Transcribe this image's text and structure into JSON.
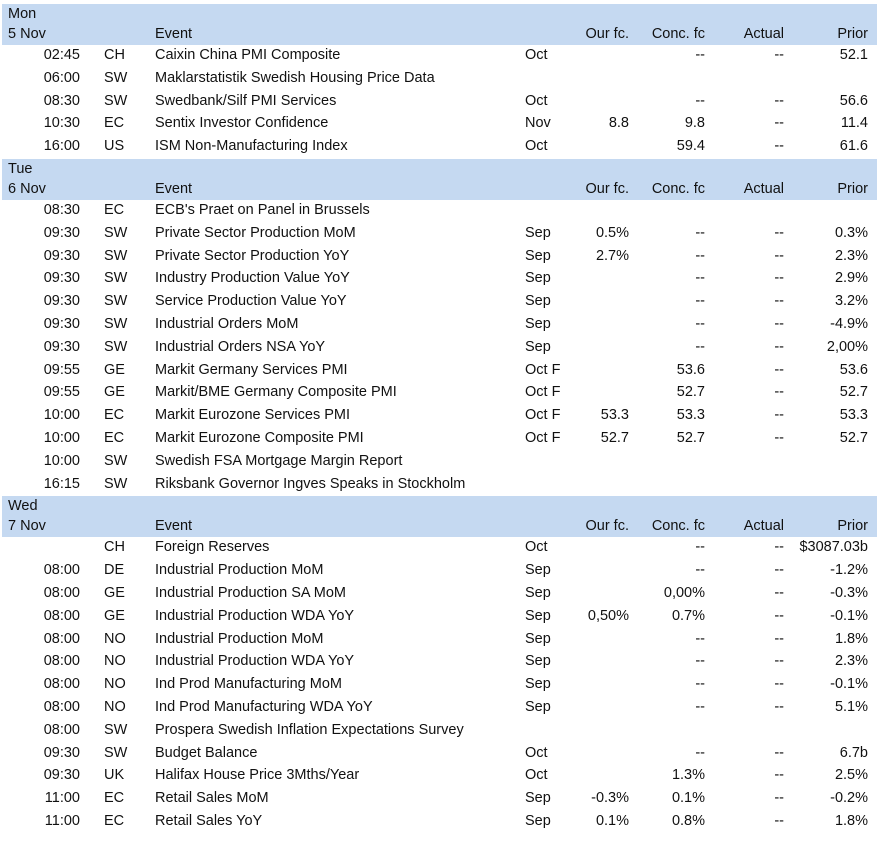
{
  "headers": {
    "event": "Event",
    "our_fc": "Our fc.",
    "conc_fc": "Conc. fc",
    "actual": "Actual",
    "prior": "Prior"
  },
  "days": [
    {
      "day": "Mon",
      "date": "5 Nov",
      "rows": [
        {
          "time": "02:45",
          "country": "CH",
          "event": "Caixin China PMI Composite",
          "period": "Oct",
          "our_fc": "",
          "conc_fc": "--",
          "actual": "--",
          "prior": "52.1"
        },
        {
          "time": "06:00",
          "country": "SW",
          "event": "Maklarstatistik Swedish Housing Price Data",
          "period": "",
          "our_fc": "",
          "conc_fc": "",
          "actual": "",
          "prior": ""
        },
        {
          "time": "08:30",
          "country": "SW",
          "event": "Swedbank/Silf PMI Services",
          "period": "Oct",
          "our_fc": "",
          "conc_fc": "--",
          "actual": "--",
          "prior": "56.6"
        },
        {
          "time": "10:30",
          "country": "EC",
          "event": "Sentix Investor Confidence",
          "period": "Nov",
          "our_fc": "8.8",
          "conc_fc": "9.8",
          "actual": "--",
          "prior": "11.4"
        },
        {
          "time": "16:00",
          "country": "US",
          "event": "ISM Non-Manufacturing Index",
          "period": "Oct",
          "our_fc": "",
          "conc_fc": "59.4",
          "actual": "--",
          "prior": "61.6"
        }
      ]
    },
    {
      "day": "Tue",
      "date": "6 Nov",
      "rows": [
        {
          "time": "08:30",
          "country": "EC",
          "event": "ECB's Praet on Panel in Brussels",
          "period": "",
          "our_fc": "",
          "conc_fc": "",
          "actual": "",
          "prior": ""
        },
        {
          "time": "09:30",
          "country": "SW",
          "event": "Private Sector Production MoM",
          "period": "Sep",
          "our_fc": "0.5%",
          "conc_fc": "--",
          "actual": "--",
          "prior": "0.3%"
        },
        {
          "time": "09:30",
          "country": "SW",
          "event": "Private Sector Production YoY",
          "period": "Sep",
          "our_fc": "2.7%",
          "conc_fc": "--",
          "actual": "--",
          "prior": "2.3%"
        },
        {
          "time": "09:30",
          "country": "SW",
          "event": "Industry Production Value YoY",
          "period": "Sep",
          "our_fc": "",
          "conc_fc": "--",
          "actual": "--",
          "prior": "2.9%"
        },
        {
          "time": "09:30",
          "country": "SW",
          "event": "Service Production Value YoY",
          "period": "Sep",
          "our_fc": "",
          "conc_fc": "--",
          "actual": "--",
          "prior": "3.2%"
        },
        {
          "time": "09:30",
          "country": "SW",
          "event": "Industrial Orders MoM",
          "period": "Sep",
          "our_fc": "",
          "conc_fc": "--",
          "actual": "--",
          "prior": "-4.9%"
        },
        {
          "time": "09:30",
          "country": "SW",
          "event": "Industrial Orders NSA YoY",
          "period": "Sep",
          "our_fc": "",
          "conc_fc": "--",
          "actual": "--",
          "prior": "2,00%"
        },
        {
          "time": "09:55",
          "country": "GE",
          "event": "Markit Germany Services PMI",
          "period": "Oct F",
          "our_fc": "",
          "conc_fc": "53.6",
          "actual": "--",
          "prior": "53.6"
        },
        {
          "time": "09:55",
          "country": "GE",
          "event": "Markit/BME Germany Composite PMI",
          "period": "Oct F",
          "our_fc": "",
          "conc_fc": "52.7",
          "actual": "--",
          "prior": "52.7"
        },
        {
          "time": "10:00",
          "country": "EC",
          "event": "Markit Eurozone Services PMI",
          "period": "Oct F",
          "our_fc": "53.3",
          "conc_fc": "53.3",
          "actual": "--",
          "prior": "53.3"
        },
        {
          "time": "10:00",
          "country": "EC",
          "event": "Markit Eurozone Composite PMI",
          "period": "Oct F",
          "our_fc": "52.7",
          "conc_fc": "52.7",
          "actual": "--",
          "prior": "52.7"
        },
        {
          "time": "10:00",
          "country": "SW",
          "event": "Swedish FSA Mortgage Margin Report",
          "period": "",
          "our_fc": "",
          "conc_fc": "",
          "actual": "",
          "prior": ""
        },
        {
          "time": "16:15",
          "country": "SW",
          "event": "Riksbank Governor Ingves Speaks in Stockholm",
          "period": "",
          "our_fc": "",
          "conc_fc": "",
          "actual": "",
          "prior": ""
        }
      ]
    },
    {
      "day": "Wed",
      "date": "7 Nov",
      "rows": [
        {
          "time": "",
          "country": "CH",
          "event": "Foreign Reserves",
          "period": "Oct",
          "our_fc": "",
          "conc_fc": "--",
          "actual": "--",
          "prior": "$3087.03b"
        },
        {
          "time": "08:00",
          "country": "DE",
          "event": "Industrial Production MoM",
          "period": "Sep",
          "our_fc": "",
          "conc_fc": "--",
          "actual": "--",
          "prior": "-1.2%"
        },
        {
          "time": "08:00",
          "country": "GE",
          "event": "Industrial Production SA MoM",
          "period": "Sep",
          "our_fc": "",
          "conc_fc": "0,00%",
          "actual": "--",
          "prior": "-0.3%"
        },
        {
          "time": "08:00",
          "country": "GE",
          "event": "Industrial Production WDA YoY",
          "period": "Sep",
          "our_fc": "0,50%",
          "conc_fc": "0.7%",
          "actual": "--",
          "prior": "-0.1%"
        },
        {
          "time": "08:00",
          "country": "NO",
          "event": "Industrial Production MoM",
          "period": "Sep",
          "our_fc": "",
          "conc_fc": "--",
          "actual": "--",
          "prior": "1.8%"
        },
        {
          "time": "08:00",
          "country": "NO",
          "event": "Industrial Production WDA YoY",
          "period": "Sep",
          "our_fc": "",
          "conc_fc": "--",
          "actual": "--",
          "prior": "2.3%"
        },
        {
          "time": "08:00",
          "country": "NO",
          "event": "Ind Prod Manufacturing MoM",
          "period": "Sep",
          "our_fc": "",
          "conc_fc": "--",
          "actual": "--",
          "prior": "-0.1%"
        },
        {
          "time": "08:00",
          "country": "NO",
          "event": "Ind Prod Manufacturing WDA YoY",
          "period": "Sep",
          "our_fc": "",
          "conc_fc": "--",
          "actual": "--",
          "prior": "5.1%"
        },
        {
          "time": "08:00",
          "country": "SW",
          "event": "Prospera Swedish Inflation Expectations Survey",
          "period": "",
          "our_fc": "",
          "conc_fc": "",
          "actual": "",
          "prior": ""
        },
        {
          "time": "09:30",
          "country": "SW",
          "event": "Budget Balance",
          "period": "Oct",
          "our_fc": "",
          "conc_fc": "--",
          "actual": "--",
          "prior": "6.7b"
        },
        {
          "time": "09:30",
          "country": "UK",
          "event": "Halifax House Price 3Mths/Year",
          "period": "Oct",
          "our_fc": "",
          "conc_fc": "1.3%",
          "actual": "--",
          "prior": "2.5%"
        },
        {
          "time": "11:00",
          "country": "EC",
          "event": "Retail Sales MoM",
          "period": "Sep",
          "our_fc": "-0.3%",
          "conc_fc": "0.1%",
          "actual": "--",
          "prior": "-0.2%"
        },
        {
          "time": "11:00",
          "country": "EC",
          "event": "Retail Sales YoY",
          "period": "Sep",
          "our_fc": "0.1%",
          "conc_fc": "0.8%",
          "actual": "--",
          "prior": "1.8%"
        }
      ]
    }
  ]
}
